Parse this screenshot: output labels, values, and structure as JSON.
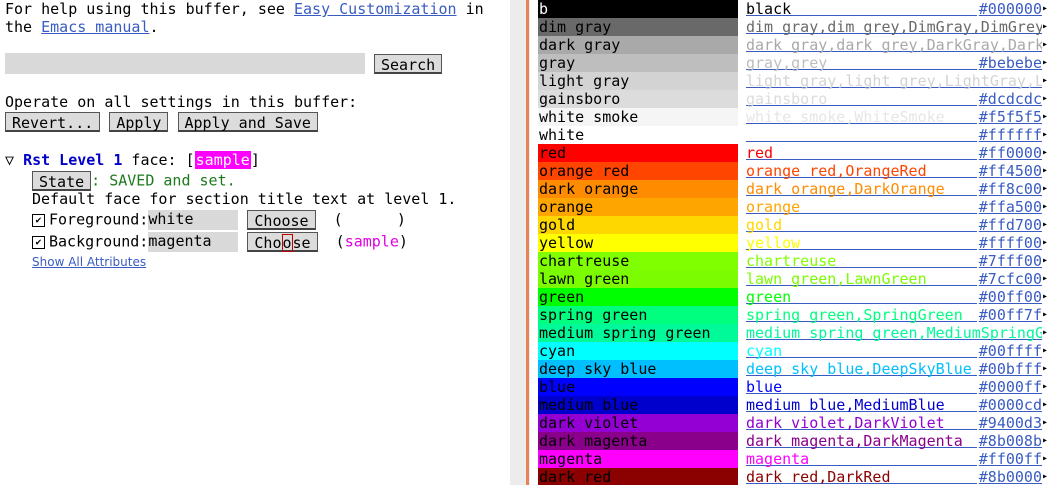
{
  "left": {
    "help_prefix": "For help using this buffer, see ",
    "help_link1": "Easy Customization",
    "help_in": " in",
    "help_the": "the ",
    "help_link2": "Emacs manual",
    "help_period": ".",
    "search_button": "Search",
    "operate_label": "Operate on all settings in this buffer:",
    "revert_button": "Revert...",
    "apply_button": "Apply",
    "apply_save_button": "Apply and Save",
    "face_toggle": "▽",
    "face_name": "Rst Level 1",
    "face_label": " face: [",
    "face_sample": "sample",
    "face_close": "]",
    "state_button": "State",
    "state_text": ": SAVED and set.",
    "doc": "Default face for section title text at level 1.",
    "fg_label": "Foreground: ",
    "fg_value": "white",
    "bg_label": "Background: ",
    "bg_value": "magenta",
    "choose_button": "Choose",
    "choose_pre": "Cho",
    "choose_cur": "o",
    "choose_post": "se",
    "fg_preview_open": "(",
    "fg_preview_close": ")",
    "bg_preview_open": "(",
    "bg_preview_sample": "sample",
    "bg_preview_close": ")",
    "check_mark": "☑",
    "show_all": "Show All Attributes"
  },
  "colors": [
    {
      "label": "b",
      "name": "black",
      "hex": "#000000",
      "bg": "#000000",
      "fg": "#ffffff",
      "nfg": "#000000"
    },
    {
      "label": "dim gray",
      "name": "dim gray,dim grey,DimGray,DimGrey",
      "hex": "",
      "bg": "#696969",
      "fg": "#000000",
      "nfg": "#696969"
    },
    {
      "label": "dark gray",
      "name": "dark gray,dark grey,DarkGray,Dark",
      "hex": "",
      "bg": "#a9a9a9",
      "fg": "#000000",
      "nfg": "#a9a9a9"
    },
    {
      "label": "gray",
      "name": "gray,grey",
      "hex": "#bebebe",
      "bg": "#bebebe",
      "fg": "#000000",
      "nfg": "#bebebe"
    },
    {
      "label": "light gray",
      "name": "light gray,light grey,LightGray,L",
      "hex": "",
      "bg": "#d3d3d3",
      "fg": "#000000",
      "nfg": "#d3d3d3"
    },
    {
      "label": "gainsboro",
      "name": "gainsboro",
      "hex": "#dcdcdc",
      "bg": "#dcdcdc",
      "fg": "#000000",
      "nfg": "#dcdcdc"
    },
    {
      "label": "white smoke",
      "name": "white smoke,WhiteSmoke",
      "hex": "#f5f5f5",
      "bg": "#f5f5f5",
      "fg": "#000000",
      "nfg": "#e6e6e6"
    },
    {
      "label": "white",
      "name": "",
      "hex": "#ffffff",
      "bg": "#ffffff",
      "fg": "#000000",
      "nfg": "#ffffff"
    },
    {
      "label": "red",
      "name": "red",
      "hex": "#ff0000",
      "bg": "#ff0000",
      "fg": "#000000",
      "nfg": "#ff0000"
    },
    {
      "label": "orange red",
      "name": "orange red,OrangeRed",
      "hex": "#ff4500",
      "bg": "#ff4500",
      "fg": "#000000",
      "nfg": "#ff4500"
    },
    {
      "label": "dark orange",
      "name": "dark orange,DarkOrange",
      "hex": "#ff8c00",
      "bg": "#ff8c00",
      "fg": "#000000",
      "nfg": "#ff8c00"
    },
    {
      "label": "orange",
      "name": "orange",
      "hex": "#ffa500",
      "bg": "#ffa500",
      "fg": "#000000",
      "nfg": "#ffa500"
    },
    {
      "label": "gold",
      "name": "gold",
      "hex": "#ffd700",
      "bg": "#ffd700",
      "fg": "#000000",
      "nfg": "#ffd700"
    },
    {
      "label": "yellow",
      "name": "yellow",
      "hex": "#ffff00",
      "bg": "#ffff00",
      "fg": "#000000",
      "nfg": "#ffff00"
    },
    {
      "label": "chartreuse",
      "name": "chartreuse",
      "hex": "#7fff00",
      "bg": "#7fff00",
      "fg": "#000000",
      "nfg": "#7fff00"
    },
    {
      "label": "lawn green",
      "name": "lawn green,LawnGreen",
      "hex": "#7cfc00",
      "bg": "#7cfc00",
      "fg": "#000000",
      "nfg": "#7cfc00"
    },
    {
      "label": "green",
      "name": "green",
      "hex": "#00ff00",
      "bg": "#00ff00",
      "fg": "#000000",
      "nfg": "#00ff00"
    },
    {
      "label": "spring green",
      "name": "spring green,SpringGreen",
      "hex": "#00ff7f",
      "bg": "#00ff7f",
      "fg": "#000000",
      "nfg": "#00ff7f"
    },
    {
      "label": "medium spring green",
      "name": "medium spring green,MediumSpringG",
      "hex": "",
      "bg": "#00fa9a",
      "fg": "#000000",
      "nfg": "#00fa9a"
    },
    {
      "label": "cyan",
      "name": "cyan",
      "hex": "#00ffff",
      "bg": "#00ffff",
      "fg": "#000000",
      "nfg": "#00ffff"
    },
    {
      "label": "deep sky blue",
      "name": "deep sky blue,DeepSkyBlue",
      "hex": "#00bfff",
      "bg": "#00bfff",
      "fg": "#000000",
      "nfg": "#00bfff"
    },
    {
      "label": "blue",
      "name": "blue",
      "hex": "#0000ff",
      "bg": "#0000ff",
      "fg": "#000000",
      "nfg": "#0000ff"
    },
    {
      "label": "medium blue",
      "name": "medium blue,MediumBlue",
      "hex": "#0000cd",
      "bg": "#0000cd",
      "fg": "#000000",
      "nfg": "#0000cd"
    },
    {
      "label": "dark violet",
      "name": "dark violet,DarkViolet",
      "hex": "#9400d3",
      "bg": "#9400d3",
      "fg": "#000000",
      "nfg": "#9400d3"
    },
    {
      "label": "dark magenta",
      "name": "dark magenta,DarkMagenta",
      "hex": "#8b008b",
      "bg": "#8b008b",
      "fg": "#000000",
      "nfg": "#8b008b"
    },
    {
      "label": "magenta",
      "name": "magenta",
      "hex": "#ff00ff",
      "bg": "#ff00ff",
      "fg": "#000000",
      "nfg": "#ff00ff"
    },
    {
      "label": "dark red",
      "name": "dark red,DarkRed",
      "hex": "#8b0000",
      "bg": "#8b0000",
      "fg": "#000000",
      "nfg": "#8b0000"
    }
  ]
}
